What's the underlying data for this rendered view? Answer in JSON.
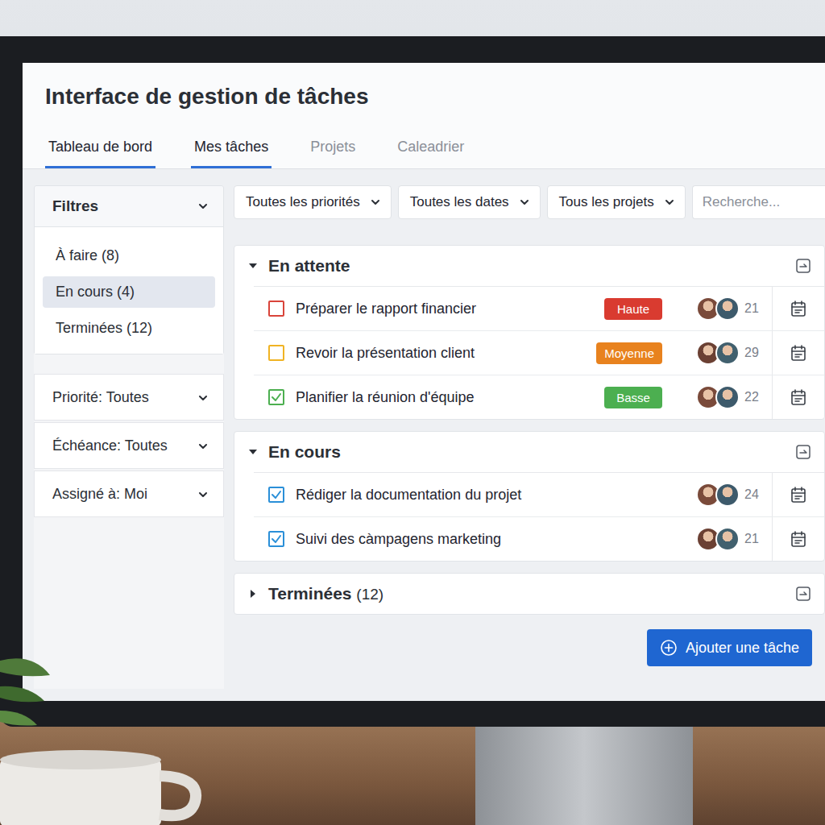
{
  "window": {
    "title": "Interface de gestion de tâches"
  },
  "tabs": [
    {
      "label": "Tableau de bord",
      "selected": true
    },
    {
      "label": "Mes tâches",
      "selected": true
    },
    {
      "label": "Projets",
      "selected": false
    },
    {
      "label": "Caleadrier",
      "selected": false
    }
  ],
  "sidebar": {
    "title": "Filtres",
    "items": [
      {
        "label": "À faire (8)",
        "selected": false
      },
      {
        "label": "En cours (4)",
        "selected": true
      },
      {
        "label": "Terminées (12)",
        "selected": false
      }
    ],
    "dropdowns": [
      {
        "label": "Priorité: Toutes"
      },
      {
        "label": "Échéance: Toutes"
      },
      {
        "label": "Assigné à: Moi"
      }
    ]
  },
  "toolbar": {
    "filters": [
      "Toutes les priorités",
      "Toutes les dates",
      "Tous les projets"
    ],
    "search": {
      "placeholder": "Recherche..."
    }
  },
  "groups": [
    {
      "title": "En attente",
      "expanded": true,
      "tasks": [
        {
          "title": "Préparer le rapport financier",
          "checked": false,
          "color": "#d9443a",
          "priority": {
            "label": "Haute",
            "color": "#d93b30"
          },
          "number": "21"
        },
        {
          "title": "Revoir la présentation client",
          "checked": false,
          "color": "#f0b323",
          "priority": {
            "label": "Moyenne",
            "color": "#e8821e"
          },
          "number": "29"
        },
        {
          "title": "Planifier la réunion d'équipe",
          "checked": true,
          "color": "#4caf50",
          "priority": {
            "label": "Basse",
            "color": "#4caf50"
          },
          "number": "22"
        }
      ]
    },
    {
      "title": "En cours",
      "expanded": true,
      "tasks": [
        {
          "title": "Rédiger la documentation du projet",
          "checked": true,
          "color": "#2a8fd8",
          "number": "24"
        },
        {
          "title": "Suivi des càmpagens marketing",
          "checked": true,
          "color": "#2a8fd8",
          "number": "21"
        }
      ]
    },
    {
      "title": "Terminées",
      "count": "(12)",
      "expanded": false,
      "tasks": []
    }
  ],
  "add_button": {
    "label": "Ajouter une tâche"
  }
}
